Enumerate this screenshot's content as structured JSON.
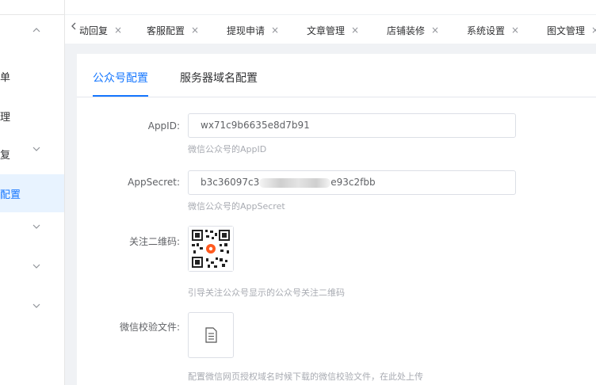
{
  "sidebar": {
    "items": [
      {
        "label": "",
        "has_chevron": true,
        "chevron": "chevron-up"
      },
      {
        "label": "单",
        "has_chevron": false
      },
      {
        "label": "理",
        "has_chevron": false
      },
      {
        "label": "复",
        "has_chevron": true,
        "chevron": "chevron-down"
      },
      {
        "label": "配置",
        "active": true,
        "has_chevron": false
      },
      {
        "label": "",
        "has_chevron": true,
        "chevron": "chevron-down"
      },
      {
        "label": "",
        "has_chevron": true,
        "chevron": "chevron-down"
      },
      {
        "label": "",
        "has_chevron": true,
        "chevron": "chevron-down"
      }
    ]
  },
  "tabs": {
    "prev_icon": "chevron-left",
    "close_glyph": "×",
    "items": [
      {
        "label": "动回复"
      },
      {
        "label": "客服配置"
      },
      {
        "label": "提现申请"
      },
      {
        "label": "文章管理"
      },
      {
        "label": "店铺装修"
      },
      {
        "label": "系统设置"
      },
      {
        "label": "图文管理"
      }
    ]
  },
  "content": {
    "tabs": [
      {
        "label": "公众号配置",
        "active": true
      },
      {
        "label": "服务器域名配置",
        "active": false
      }
    ],
    "form": {
      "appid": {
        "label": "AppID:",
        "value": "wx71c9b6635e8d7b91",
        "help": "微信公众号的AppID"
      },
      "appsecret": {
        "label": "AppSecret:",
        "value_prefix": "b3c36097c3",
        "value_suffix": "e93c2fbb",
        "help": "微信公众号的AppSecret"
      },
      "qrcode": {
        "label": "关注二维码:",
        "help": "引导关注公众号显示的公众号关注二维码"
      },
      "verify_file": {
        "label": "微信校验文件:",
        "help": "配置微信网页授权域名时候下载的微信校验文件，在此处上传"
      }
    }
  },
  "colors": {
    "accent": "#1677ff",
    "active_bg": "#e8f3ff",
    "help_text": "#a8abb2",
    "border": "#dcdfe6"
  }
}
